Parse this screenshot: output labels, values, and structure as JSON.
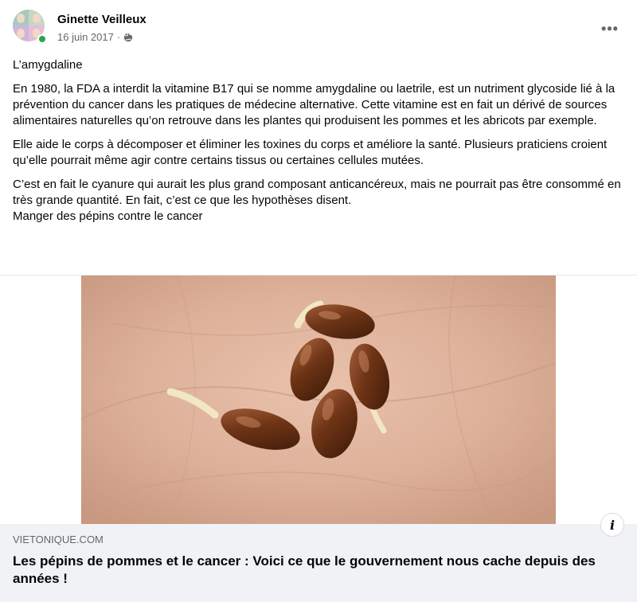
{
  "post": {
    "author": "Ginette Veilleux",
    "date": "16 juin 2017",
    "separator": "·",
    "privacy_icon": "globe-icon",
    "more_icon": "more-horizontal-icon",
    "more_label": "•••",
    "online_status_color": "#31a24c"
  },
  "body": {
    "heading": "L’amygdaline",
    "paragraphs": [
      "En 1980, la FDA a interdit la vitamine B17 qui se nomme amygdaline ou laetrile, est un nutriment glycoside lié à la prévention du cancer dans les pratiques de médecine alternative. Cette vitamine est en fait un dérivé de sources alimentaires naturelles qu’on retrouve dans les plantes qui produisent les pommes et les abricots par exemple.",
      "Elle aide le corps à décomposer et éliminer les toxines du corps et améliore la santé. Plusieurs praticiens croient qu’elle pourrait même agir contre certains tissus ou certaines cellules mutées.",
      "C’est en fait le cyanure qui aurait les plus grand composant anticancéreux, mais ne pourrait pas être consommé en très grande quantité. En fait, c’est ce que les hypothèses disent."
    ],
    "closing_line": "Manger des pépins contre le cancer"
  },
  "link_preview": {
    "domain": "VIETONIQUE.COM",
    "title": "Les pépins de pommes et le cancer : Voici ce que le gouvernement nous cache depuis des années !",
    "info_icon": "info-icon",
    "info_label": "i"
  }
}
